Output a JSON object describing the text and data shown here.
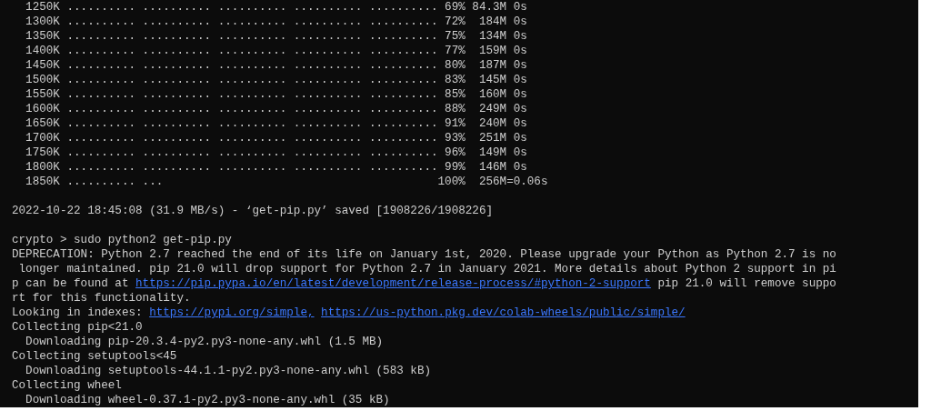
{
  "terminal": {
    "lines": [
      {
        "kind": "text",
        "text": "  1250K .......... .......... .......... .......... .......... 69% 84.3M 0s"
      },
      {
        "kind": "text",
        "text": "  1300K .......... .......... .......... .......... .......... 72%  184M 0s"
      },
      {
        "kind": "text",
        "text": "  1350K .......... .......... .......... .......... .......... 75%  134M 0s"
      },
      {
        "kind": "text",
        "text": "  1400K .......... .......... .......... .......... .......... 77%  159M 0s"
      },
      {
        "kind": "text",
        "text": "  1450K .......... .......... .......... .......... .......... 80%  187M 0s"
      },
      {
        "kind": "text",
        "text": "  1500K .......... .......... .......... .......... .......... 83%  145M 0s"
      },
      {
        "kind": "text",
        "text": "  1550K .......... .......... .......... .......... .......... 85%  160M 0s"
      },
      {
        "kind": "text",
        "text": "  1600K .......... .......... .......... .......... .......... 88%  249M 0s"
      },
      {
        "kind": "text",
        "text": "  1650K .......... .......... .......... .......... .......... 91%  240M 0s"
      },
      {
        "kind": "text",
        "text": "  1700K .......... .......... .......... .......... .......... 93%  251M 0s"
      },
      {
        "kind": "text",
        "text": "  1750K .......... .......... .......... .......... .......... 96%  149M 0s"
      },
      {
        "kind": "text",
        "text": "  1800K .......... .......... .......... .......... .......... 99%  146M 0s"
      },
      {
        "kind": "text",
        "text": "  1850K .......... ...                                        100%  256M=0.06s"
      },
      {
        "kind": "blank"
      },
      {
        "kind": "text",
        "text": "2022-10-22 18:45:08 (31.9 MB/s) - ‘get-pip.py’ saved [1908226/1908226]"
      },
      {
        "kind": "blank"
      },
      {
        "kind": "text",
        "text": "crypto > sudo python2 get-pip.py"
      },
      {
        "kind": "text",
        "text": "DEPRECATION: Python 2.7 reached the end of its life on January 1st, 2020. Please upgrade your Python as Python 2.7 is no"
      },
      {
        "kind": "text",
        "text": " longer maintained. pip 21.0 will drop support for Python 2.7 in January 2021. More details about Python 2 support in pi"
      },
      {
        "kind": "mixed",
        "parts": [
          {
            "kind": "text",
            "text": "p can be found at "
          },
          {
            "kind": "link",
            "text": "https://pip.pypa.io/en/latest/development/release-process/#python-2-support"
          },
          {
            "kind": "text",
            "text": " pip 21.0 will remove suppo"
          }
        ]
      },
      {
        "kind": "text",
        "text": "rt for this functionality."
      },
      {
        "kind": "mixed",
        "parts": [
          {
            "kind": "text",
            "text": "Looking in indexes: "
          },
          {
            "kind": "link",
            "text": "https://pypi.org/simple,"
          },
          {
            "kind": "link",
            "text": "https://us-python.pkg.dev/colab-wheels/public/simple/"
          }
        ]
      },
      {
        "kind": "text",
        "text": "Collecting pip<21.0"
      },
      {
        "kind": "text",
        "text": "  Downloading pip-20.3.4-py2.py3-none-any.whl (1.5 MB)"
      },
      {
        "kind": "text",
        "text": "Collecting setuptools<45"
      },
      {
        "kind": "text",
        "text": "  Downloading setuptools-44.1.1-py2.py3-none-any.whl (583 kB)"
      },
      {
        "kind": "text",
        "text": "Collecting wheel"
      },
      {
        "kind": "text",
        "text": "  Downloading wheel-0.37.1-py2.py3-none-any.whl (35 kB)"
      }
    ]
  }
}
